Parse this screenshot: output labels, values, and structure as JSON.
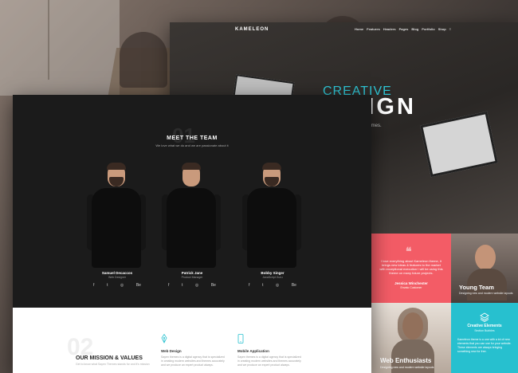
{
  "back_site": {
    "logo": "KAMELEON",
    "menu": [
      "Home",
      "Features",
      "Headers",
      "Pages",
      "Blog",
      "Portfolio",
      "Shop",
      "≡"
    ],
    "hero_small": "CREATIVE",
    "hero_big": "SIGN",
    "hero_sub": "dPress themes."
  },
  "tiles": {
    "testimonial": {
      "quote": "I love everything about Kameleon theme, it brings new ideas & features to the market with exceptional execution I will be using this theme on many future projects.",
      "name": "Jessica Winchester",
      "role": "Envato Customer"
    },
    "young_team": {
      "title": "Young Team",
      "sub": "Designing new and modern website layouts"
    },
    "web_enthusiasts": {
      "title": "Web Enthusiasts",
      "sub": "Designing new and modern website layouts"
    },
    "creative_elements": {
      "title": "Creative Elements",
      "role": "Section Bubbles",
      "text": "Kameleon theme is a one with a lot of new elements that you can use for your website. These elements are always bringing something new for free."
    }
  },
  "team": {
    "number": "01",
    "title": "MEET THE TEAM",
    "subtitle": "We love what we do and we are passionate about it",
    "members": [
      {
        "name": "Samuel Decaccos",
        "role": "Web Designer"
      },
      {
        "name": "Patrick Jane",
        "role": "Product Manager"
      },
      {
        "name": "Bobby Singer",
        "role": "JavaScript Guru"
      }
    ],
    "social": [
      "f",
      "t",
      "◎",
      "Be"
    ]
  },
  "mission": {
    "number": "02",
    "title": "OUR MISSION & VALUES",
    "subtitle": "Get to know what Sayen Themes stands for and it's mission",
    "features": [
      {
        "title": "Web Design",
        "text": "Sayen themes is a digital agency that is specialized in creating modern websites and themes accurately and we produce an expert product always."
      },
      {
        "title": "Mobile Application",
        "text": "Sayen themes is a digital agency that is specialized in creating modern websites and themes accurately and we produce an expert product always."
      }
    ]
  },
  "colors": {
    "accent": "#27c0cf",
    "red": "#f35c66",
    "dark": "#1b1b1b"
  }
}
